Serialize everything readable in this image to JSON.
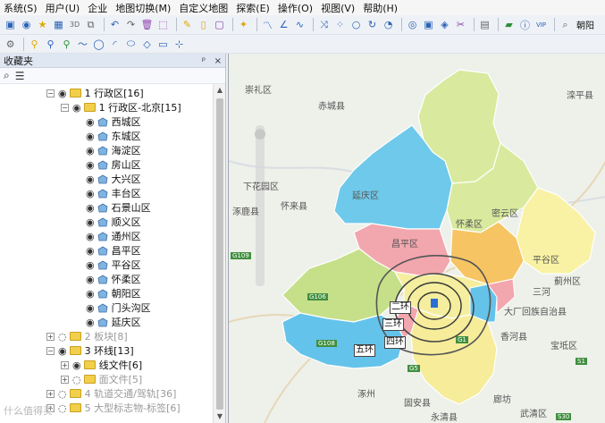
{
  "menu": [
    "系统(S)",
    "用户(U)",
    "企业",
    "地图切换(M)",
    "自定义地图",
    "探索(E)",
    "操作(O)",
    "视图(V)",
    "帮助(H)"
  ],
  "toolbar": {
    "search_value": "朝阳"
  },
  "panel": {
    "title": "收藏夹",
    "pin_label": "ᵖ",
    "close_label": "×"
  },
  "tree": {
    "group1": "1 行政区[16]",
    "group1_sub": "1 行政区-北京[15]",
    "districts": [
      "西城区",
      "东城区",
      "海淀区",
      "房山区",
      "大兴区",
      "丰台区",
      "石景山区",
      "顺义区",
      "通州区",
      "昌平区",
      "平谷区",
      "怀柔区",
      "朝阳区",
      "门头沟区",
      "延庆区"
    ],
    "group2": "2 板块[8]",
    "group3": "3 环线[13]",
    "group3_lines": "线文件[6]",
    "group3_areas": "面文件[5]",
    "group4": "4 轨道交通/驾轨[36]",
    "group5": "5 大型标志物-标签[6]"
  },
  "map": {
    "place_labels": [
      "赤城县",
      "崇礼区",
      "滦平县",
      "延庆区",
      "怀柔区",
      "密云区",
      "昌平区",
      "平谷区",
      "下花园区",
      "涿鹿县",
      "怀来县",
      "三河",
      "蓟州区",
      "大厂回族自治县",
      "香河县",
      "宝坻区",
      "涿州",
      "固安县",
      "永清县",
      "武清区",
      "廊坊"
    ],
    "ring_labels": [
      "二环",
      "三环",
      "四环",
      "五环"
    ],
    "road_badges": [
      "G109",
      "G108",
      "G106",
      "G1",
      "S1",
      "S30",
      "G5"
    ]
  },
  "watermark": "什么值得买"
}
